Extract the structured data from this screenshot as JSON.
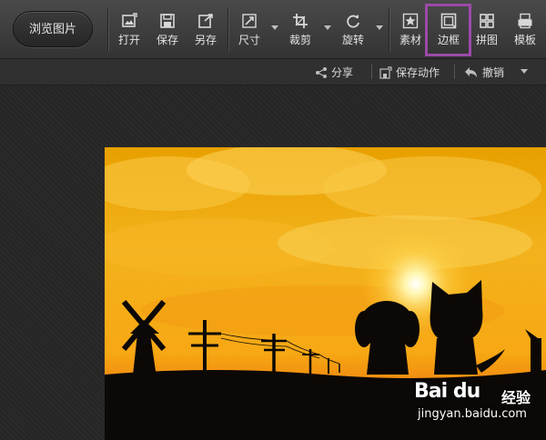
{
  "toolbar": {
    "browse_label": "浏览图片",
    "tools": [
      {
        "id": "open",
        "label": "打开",
        "icon": "open-image-icon"
      },
      {
        "id": "save",
        "label": "保存",
        "icon": "save-icon"
      },
      {
        "id": "saveas",
        "label": "另存",
        "icon": "save-as-icon"
      },
      {
        "id": "resize",
        "label": "尺寸",
        "icon": "resize-icon"
      },
      {
        "id": "crop",
        "label": "裁剪",
        "icon": "crop-icon"
      },
      {
        "id": "rotate",
        "label": "旋转",
        "icon": "rotate-icon"
      },
      {
        "id": "material",
        "label": "素材",
        "icon": "star-icon"
      },
      {
        "id": "border",
        "label": "边框",
        "icon": "border-icon"
      },
      {
        "id": "collage",
        "label": "拼图",
        "icon": "grid-icon"
      },
      {
        "id": "template",
        "label": "模板",
        "icon": "template-icon"
      }
    ],
    "highlight_color": "#9b4aa8"
  },
  "subbar": {
    "share_label": "分享",
    "save_action_label": "保存动作",
    "undo_label": "撤销"
  },
  "watermark": {
    "brand": "Bai du",
    "cn": "经验",
    "url": "jingyan.baidu.com"
  }
}
